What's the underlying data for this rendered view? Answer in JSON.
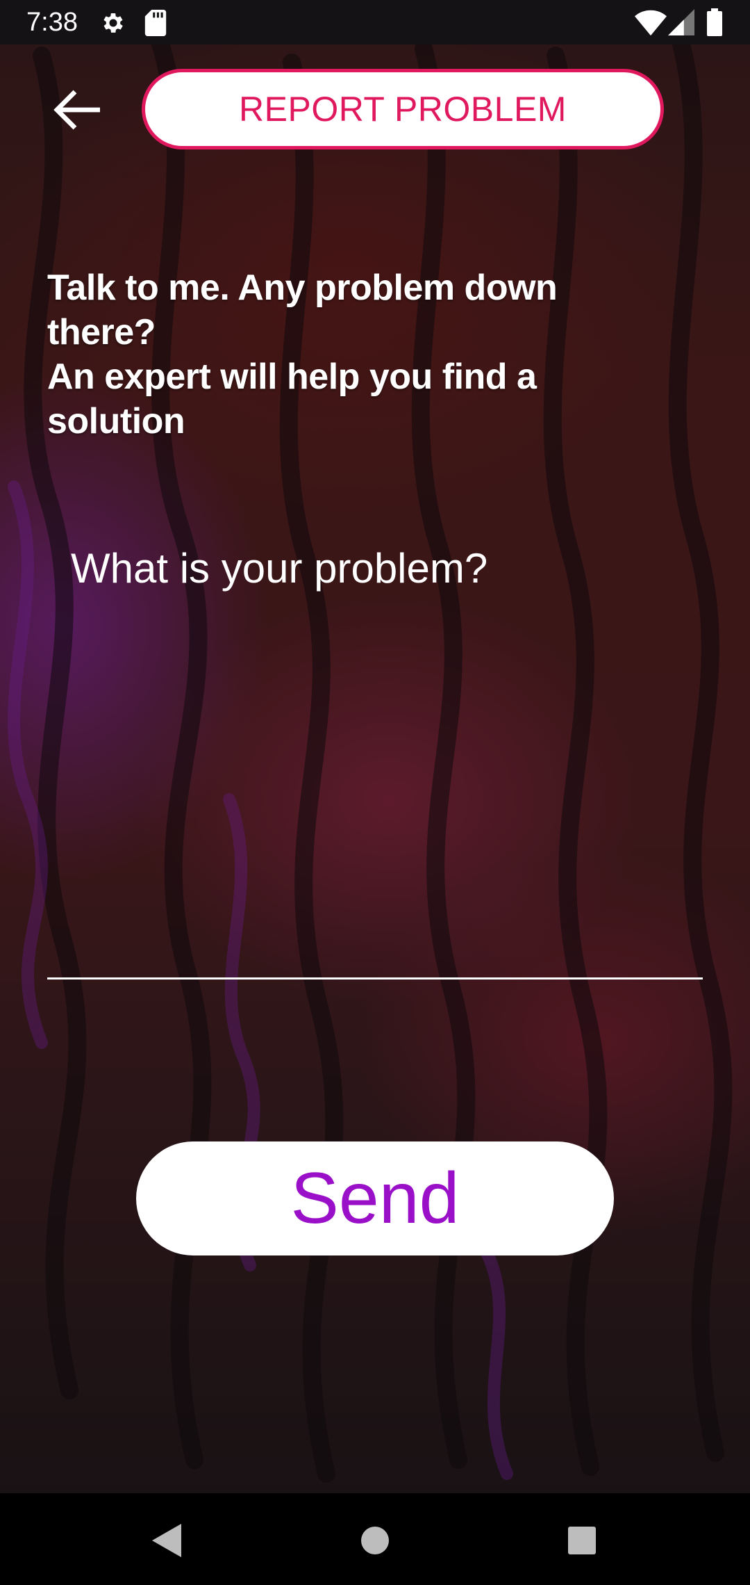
{
  "status_bar": {
    "time": "7:38",
    "left_icons": [
      "settings-gear-icon",
      "sd-card-icon"
    ],
    "right_icons": [
      "wifi-icon",
      "cellular-signal-icon",
      "battery-icon"
    ]
  },
  "header": {
    "back_icon": "arrow-left-icon",
    "title": "REPORT PROBLEM"
  },
  "intro": {
    "lines": [
      "Talk to me. Any problem down",
      "there?",
      "An expert will help you find a",
      "solution"
    ]
  },
  "problem_input": {
    "value": "",
    "placeholder": "What is your problem?"
  },
  "send_button": {
    "label": "Send"
  },
  "nav_bar": {
    "back_icon": "triangle-back-icon",
    "home_icon": "circle-home-icon",
    "recents_icon": "square-recents-icon"
  },
  "colors": {
    "accent_pink": "#e0185e",
    "send_purple": "#9a10c8",
    "status_bar_bg": "#141214",
    "nav_bar_bg": "#000000"
  }
}
